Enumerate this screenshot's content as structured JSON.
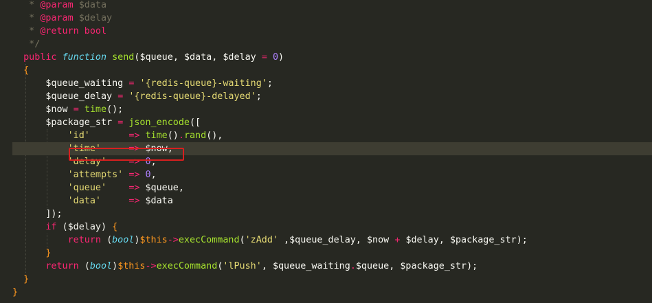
{
  "theme": {
    "background": "#272822",
    "current_line": "#3e3d32",
    "highlight_box": "#d81f1f",
    "colors": {
      "text": "#f8f8f2",
      "comment": "#75715e",
      "tag": "#f92672",
      "keyword": "#f92672",
      "storage": "#66d9ef",
      "function": "#a6e22e",
      "string": "#e6db74",
      "number": "#ae81ff",
      "operator": "#f92672",
      "brace": "#fd971f",
      "type": "#66d9ef"
    }
  },
  "editor": {
    "highlighted_line_index": 11,
    "lines": [
      {
        "tokens": [
          [
            "   * ",
            "comment"
          ],
          [
            "@param",
            "tag"
          ],
          [
            " $data",
            "comment"
          ]
        ]
      },
      {
        "tokens": [
          [
            "   * ",
            "comment"
          ],
          [
            "@param",
            "tag"
          ],
          [
            " $delay",
            "comment"
          ]
        ]
      },
      {
        "tokens": [
          [
            "   * ",
            "comment"
          ],
          [
            "@return",
            "tag"
          ],
          [
            " bool",
            "tag"
          ]
        ]
      },
      {
        "tokens": [
          [
            "   */",
            "comment"
          ]
        ]
      },
      {
        "tokens": [
          [
            "  ",
            "text"
          ],
          [
            "public",
            "keyword"
          ],
          [
            " ",
            "text"
          ],
          [
            "function",
            "storage"
          ],
          [
            " ",
            "text"
          ],
          [
            "send",
            "function"
          ],
          [
            "(",
            "text"
          ],
          [
            "$queue",
            "text"
          ],
          [
            ", ",
            "text"
          ],
          [
            "$data",
            "text"
          ],
          [
            ", ",
            "text"
          ],
          [
            "$delay",
            "text"
          ],
          [
            " ",
            "text"
          ],
          [
            "=",
            "operator"
          ],
          [
            " ",
            "text"
          ],
          [
            "0",
            "number"
          ],
          [
            ")",
            "text"
          ]
        ]
      },
      {
        "tokens": [
          [
            "  ",
            "text"
          ],
          [
            "{",
            "brace"
          ]
        ]
      },
      {
        "tokens": [
          [
            "      ",
            "text"
          ],
          [
            "$queue_waiting",
            "text"
          ],
          [
            " ",
            "text"
          ],
          [
            "=",
            "operator"
          ],
          [
            " ",
            "text"
          ],
          [
            "'{redis-queue}-waiting'",
            "string"
          ],
          [
            ";",
            "text"
          ]
        ]
      },
      {
        "tokens": [
          [
            "      ",
            "text"
          ],
          [
            "$queue_delay",
            "text"
          ],
          [
            " ",
            "text"
          ],
          [
            "=",
            "operator"
          ],
          [
            " ",
            "text"
          ],
          [
            "'{redis-queue}-delayed'",
            "string"
          ],
          [
            ";",
            "text"
          ]
        ]
      },
      {
        "tokens": [
          [
            "      ",
            "text"
          ],
          [
            "$now",
            "text"
          ],
          [
            " ",
            "text"
          ],
          [
            "=",
            "operator"
          ],
          [
            " ",
            "text"
          ],
          [
            "time",
            "function"
          ],
          [
            "();",
            "text"
          ]
        ]
      },
      {
        "tokens": [
          [
            "      ",
            "text"
          ],
          [
            "$package_str",
            "text"
          ],
          [
            " ",
            "text"
          ],
          [
            "=",
            "operator"
          ],
          [
            " ",
            "text"
          ],
          [
            "json_encode",
            "function"
          ],
          [
            "([",
            "text"
          ]
        ]
      },
      {
        "tokens": [
          [
            "          ",
            "text"
          ],
          [
            "'id'",
            "string"
          ],
          [
            "       ",
            "text"
          ],
          [
            "=>",
            "operator"
          ],
          [
            " ",
            "text"
          ],
          [
            "time",
            "function"
          ],
          [
            "()",
            "text"
          ],
          [
            ".",
            "operator"
          ],
          [
            "rand",
            "function"
          ],
          [
            "(),",
            "text"
          ]
        ]
      },
      {
        "tokens": [
          [
            "          ",
            "text"
          ],
          [
            "'time'",
            "string"
          ],
          [
            "     ",
            "text"
          ],
          [
            "=>",
            "operator"
          ],
          [
            " ",
            "text"
          ],
          [
            "$now",
            "text"
          ],
          [
            ",",
            "text"
          ]
        ]
      },
      {
        "tokens": [
          [
            "          ",
            "text"
          ],
          [
            "'delay'",
            "string"
          ],
          [
            "    ",
            "text"
          ],
          [
            "=>",
            "operator"
          ],
          [
            " ",
            "text"
          ],
          [
            "0",
            "number"
          ],
          [
            ",",
            "text"
          ]
        ]
      },
      {
        "tokens": [
          [
            "          ",
            "text"
          ],
          [
            "'attempts'",
            "string"
          ],
          [
            " ",
            "text"
          ],
          [
            "=>",
            "operator"
          ],
          [
            " ",
            "text"
          ],
          [
            "0",
            "number"
          ],
          [
            ",",
            "text"
          ]
        ]
      },
      {
        "tokens": [
          [
            "          ",
            "text"
          ],
          [
            "'queue'",
            "string"
          ],
          [
            "    ",
            "text"
          ],
          [
            "=>",
            "operator"
          ],
          [
            " ",
            "text"
          ],
          [
            "$queue",
            "text"
          ],
          [
            ",",
            "text"
          ]
        ]
      },
      {
        "tokens": [
          [
            "          ",
            "text"
          ],
          [
            "'data'",
            "string"
          ],
          [
            "     ",
            "text"
          ],
          [
            "=>",
            "operator"
          ],
          [
            " ",
            "text"
          ],
          [
            "$data",
            "text"
          ]
        ]
      },
      {
        "tokens": [
          [
            "      ",
            "text"
          ],
          [
            "]);",
            "text"
          ]
        ]
      },
      {
        "tokens": [
          [
            "      ",
            "text"
          ],
          [
            "if",
            "keyword"
          ],
          [
            " ",
            "text"
          ],
          [
            "(",
            "text"
          ],
          [
            "$delay",
            "text"
          ],
          [
            ") ",
            "text"
          ],
          [
            "{",
            "brace"
          ]
        ]
      },
      {
        "tokens": [
          [
            "          ",
            "text"
          ],
          [
            "return",
            "keyword"
          ],
          [
            " ",
            "text"
          ],
          [
            "(",
            "text"
          ],
          [
            "bool",
            "type"
          ],
          [
            ")",
            "text"
          ],
          [
            "$this",
            "brace"
          ],
          [
            "->",
            "operator"
          ],
          [
            "execCommand",
            "function"
          ],
          [
            "(",
            "text"
          ],
          [
            "'zAdd'",
            "string"
          ],
          [
            " ,",
            "text"
          ],
          [
            "$queue_delay",
            "text"
          ],
          [
            ", ",
            "text"
          ],
          [
            "$now",
            "text"
          ],
          [
            " ",
            "text"
          ],
          [
            "+",
            "operator"
          ],
          [
            " ",
            "text"
          ],
          [
            "$delay",
            "text"
          ],
          [
            ", ",
            "text"
          ],
          [
            "$package_str",
            "text"
          ],
          [
            ");",
            "text"
          ]
        ]
      },
      {
        "tokens": [
          [
            "      ",
            "text"
          ],
          [
            "}",
            "brace"
          ]
        ]
      },
      {
        "tokens": [
          [
            "      ",
            "text"
          ],
          [
            "return",
            "keyword"
          ],
          [
            " ",
            "text"
          ],
          [
            "(",
            "text"
          ],
          [
            "bool",
            "type"
          ],
          [
            ")",
            "text"
          ],
          [
            "$this",
            "brace"
          ],
          [
            "->",
            "operator"
          ],
          [
            "execCommand",
            "function"
          ],
          [
            "(",
            "text"
          ],
          [
            "'lPush'",
            "string"
          ],
          [
            ", ",
            "text"
          ],
          [
            "$queue_waiting",
            "text"
          ],
          [
            ".",
            "operator"
          ],
          [
            "$queue",
            "text"
          ],
          [
            ", ",
            "text"
          ],
          [
            "$package_str",
            "text"
          ],
          [
            ");",
            "text"
          ]
        ]
      },
      {
        "tokens": [
          [
            "  ",
            "text"
          ],
          [
            "}",
            "brace"
          ]
        ]
      },
      {
        "tokens": [
          [
            "}",
            "brace"
          ]
        ]
      }
    ]
  }
}
